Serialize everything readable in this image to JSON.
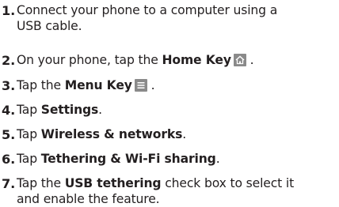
{
  "steps": [
    {
      "num": "1.",
      "pre": "Connect your phone to a computer using a",
      "bold": "",
      "post": "",
      "line2": "USB cable."
    },
    {
      "num": "2.",
      "pre": "On your phone, tap the ",
      "bold": "Home Key",
      "post": " .",
      "icon": "home-icon",
      "line2": ""
    },
    {
      "num": "3.",
      "pre": "Tap the ",
      "bold": "Menu Key",
      "post": " .",
      "icon": "menu-icon",
      "line2": ""
    },
    {
      "num": "4.",
      "pre": "Tap ",
      "bold": "Settings",
      "post": ".",
      "line2": ""
    },
    {
      "num": "5.",
      "pre": "Tap ",
      "bold": "Wireless & networks",
      "post": ".",
      "line2": ""
    },
    {
      "num": "6.",
      "pre": "Tap ",
      "bold": "Tethering & Wi-Fi sharing",
      "post": ".",
      "line2": ""
    },
    {
      "num": "7.",
      "pre": "Tap the ",
      "bold": "USB tethering",
      "post": " check box to select it",
      "line2": "and enable the feature."
    }
  ],
  "colors": {
    "text": "#231f20",
    "icon_bg": "#8a8a8a",
    "icon_fg": "#ffffff"
  }
}
